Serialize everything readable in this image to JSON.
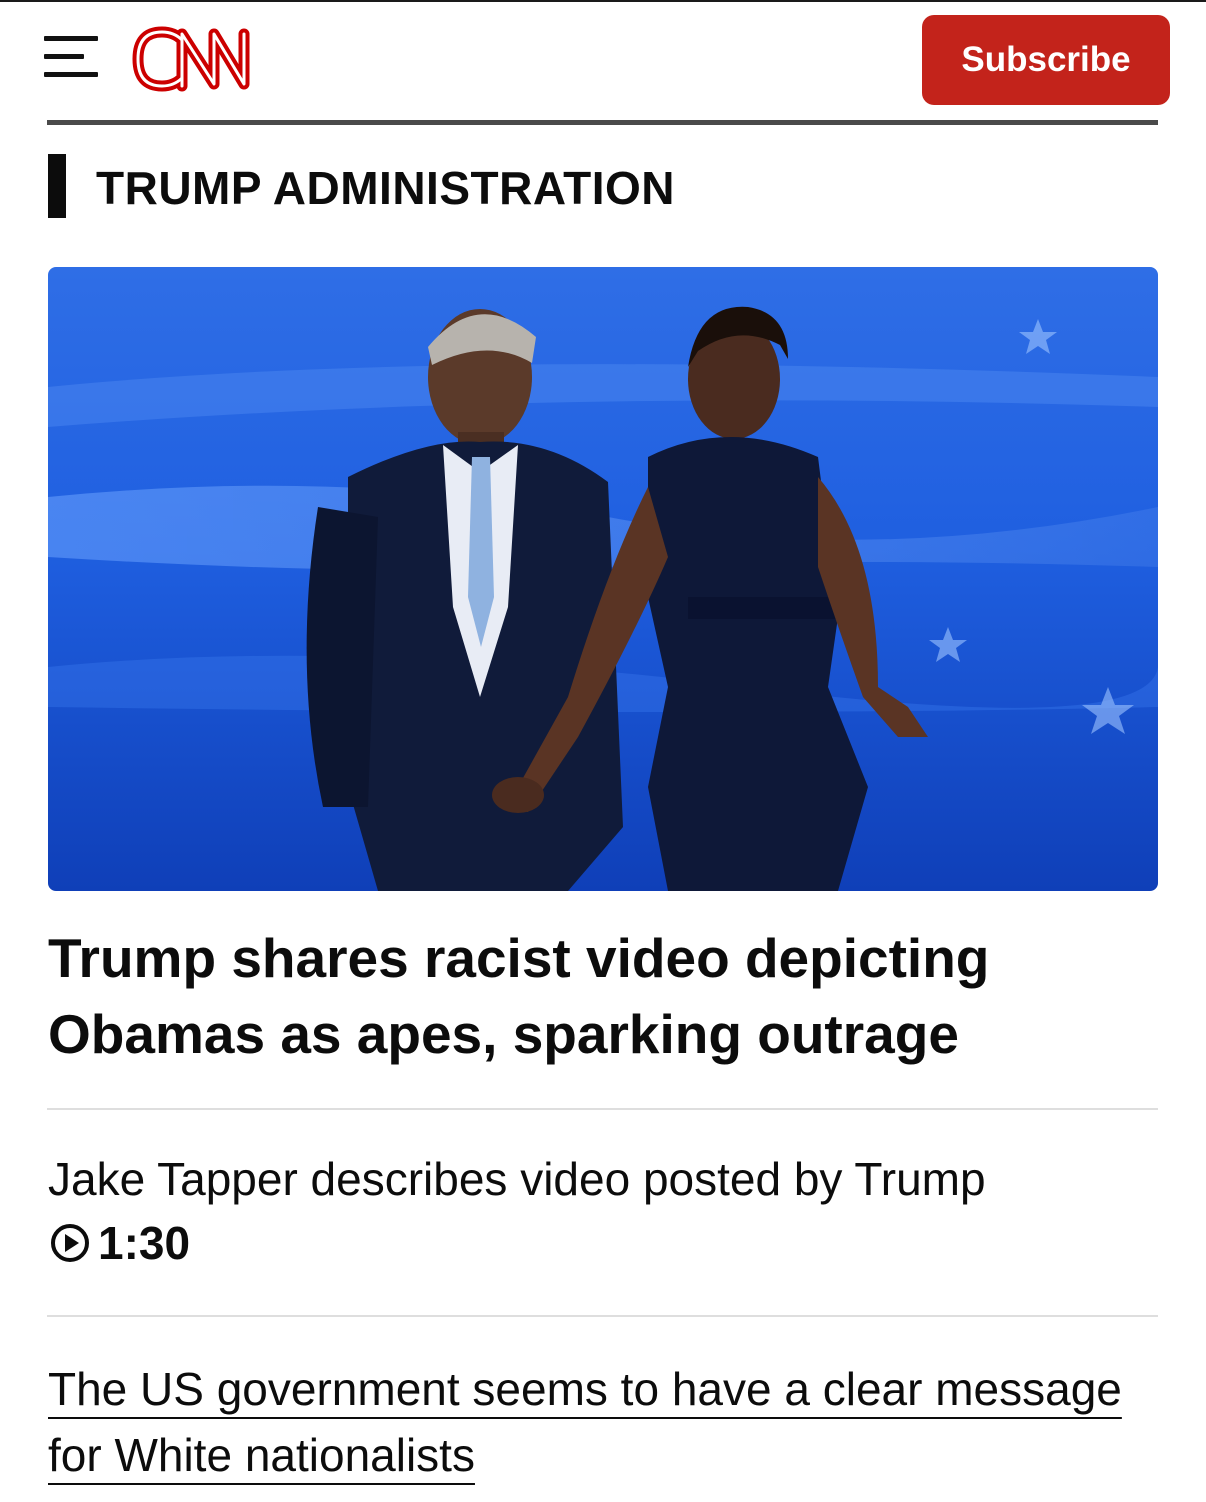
{
  "header": {
    "menu_icon": "hamburger-menu-icon",
    "logo_text": "CNN",
    "logo_color": "#cc0000",
    "subscribe_label": "Subscribe",
    "subscribe_color": "#c3231b"
  },
  "section": {
    "title": "TRUMP ADMINISTRATION"
  },
  "article": {
    "hero_image": "Barack and Michelle Obama holding hands on stage in front of a blue flag backdrop",
    "headline": "Trump shares racist video depicting Obamas as apes, sparking outrage"
  },
  "video": {
    "description": "Jake Tapper describes video posted by Trump",
    "play_icon": "play-circle-icon",
    "duration": "1:30"
  },
  "related": {
    "link_text": "The US government seems to have a clear message for White nationalists"
  }
}
